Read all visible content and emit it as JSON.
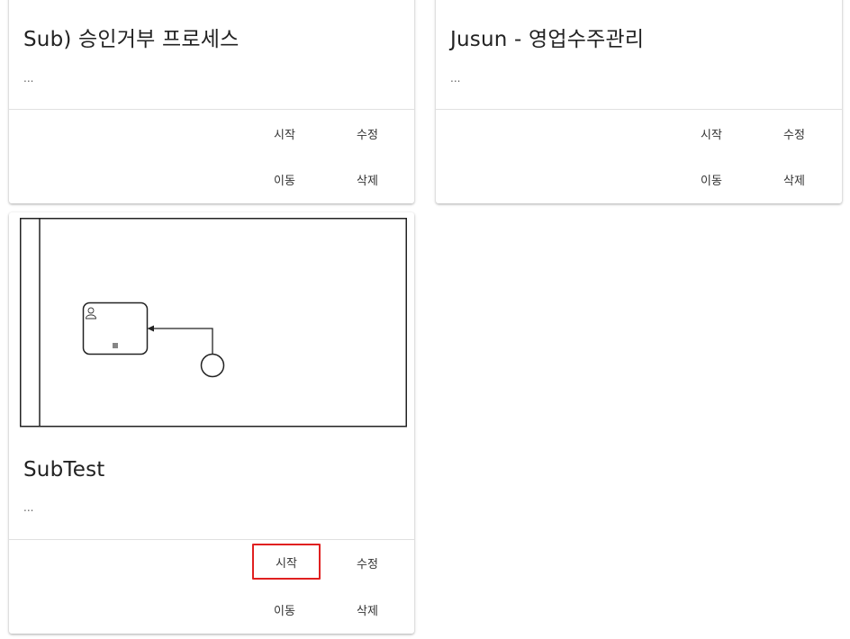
{
  "cards": [
    {
      "title": "Sub) 승인거부 프로세스",
      "description": "...",
      "actions": {
        "start": "시작",
        "edit": "수정",
        "move": "이동",
        "delete": "삭제"
      }
    },
    {
      "title": "Jusun - 영업수주관리",
      "description": "...",
      "actions": {
        "start": "시작",
        "edit": "수정",
        "move": "이동",
        "delete": "삭제"
      }
    },
    {
      "title": "SubTest",
      "description": "...",
      "actions": {
        "start": "시작",
        "edit": "수정",
        "move": "이동",
        "delete": "삭제"
      },
      "highlighted_action": "start"
    }
  ],
  "colors": {
    "highlight": "#e02020",
    "divider": "#e0e0e0",
    "diagram_stroke": "#222222"
  },
  "icons": [
    "user-task-icon",
    "multi-instance-marker-icon",
    "start-event-icon"
  ]
}
